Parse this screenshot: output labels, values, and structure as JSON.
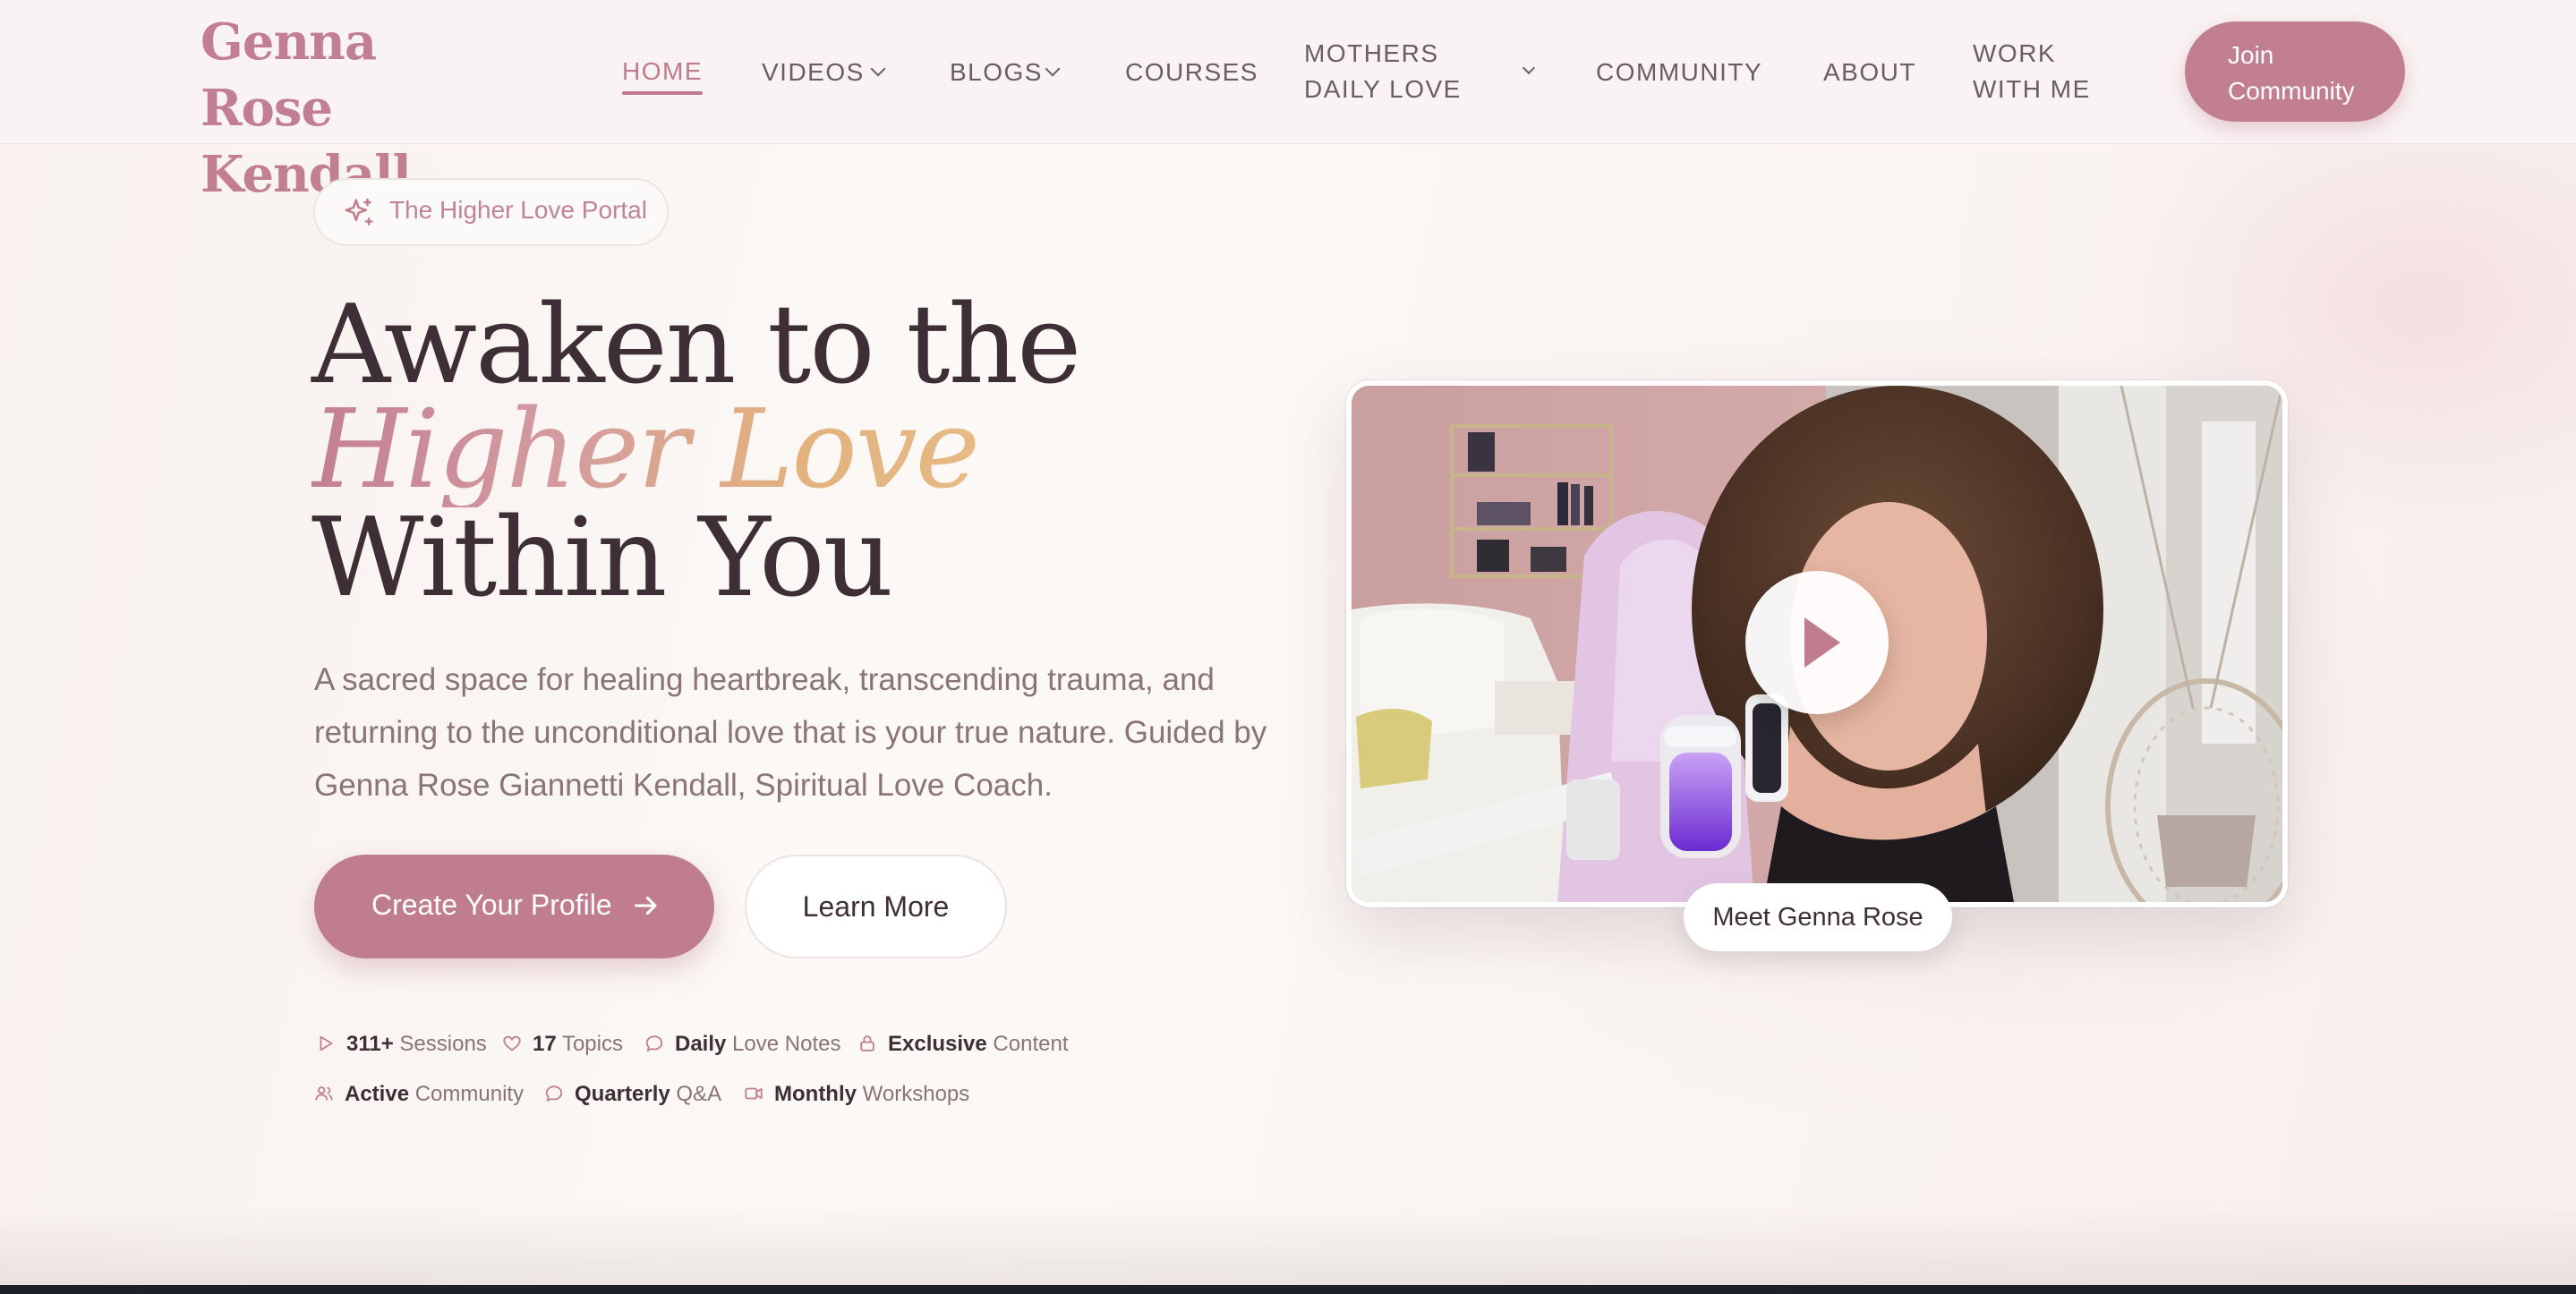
{
  "header": {
    "logo": [
      "Genna Rose",
      "Kendall"
    ],
    "nav": {
      "home": "HOME",
      "videos": "VIDEOS",
      "blogs": "BLOGS",
      "courses": "COURSES",
      "mothers": [
        "MOTHERS",
        "DAILY LOVE"
      ],
      "community": "COMMUNITY",
      "about": "ABOUT",
      "work": [
        "WORK",
        "WITH ME"
      ]
    },
    "join_button": [
      "Join",
      "Community"
    ]
  },
  "hero": {
    "badge": "The Higher Love Portal",
    "headline": [
      "Awaken to the",
      "Higher Love",
      "Within You"
    ],
    "lead": "A sacred space for healing heartbreak, transcending trauma, and returning to the unconditional love that is your true nature. Guided by Genna Rose Giannetti Kendall, Spiritual Love Coach.",
    "primary_cta": "Create Your Profile",
    "secondary_cta": "Learn More",
    "stats": [
      {
        "bold": "311+",
        "text": "Sessions",
        "icon": "play-icon"
      },
      {
        "bold": "17",
        "text": "Topics",
        "icon": "heart-icon"
      },
      {
        "bold": "Daily",
        "text": "Love Notes",
        "icon": "chat-icon"
      },
      {
        "bold": "Exclusive",
        "text": "Content",
        "icon": "lock-icon"
      },
      {
        "bold": "Active",
        "text": "Community",
        "icon": "users-icon"
      },
      {
        "bold": "Quarterly",
        "text": "Q&A",
        "icon": "chat-icon"
      },
      {
        "bold": "Monthly",
        "text": "Workshops",
        "icon": "video-icon"
      }
    ]
  },
  "video": {
    "caption": "Meet Genna Rose"
  },
  "colors": {
    "accent": "#c27f92",
    "heading": "#3e2f37",
    "gold": "#e3b27e"
  }
}
